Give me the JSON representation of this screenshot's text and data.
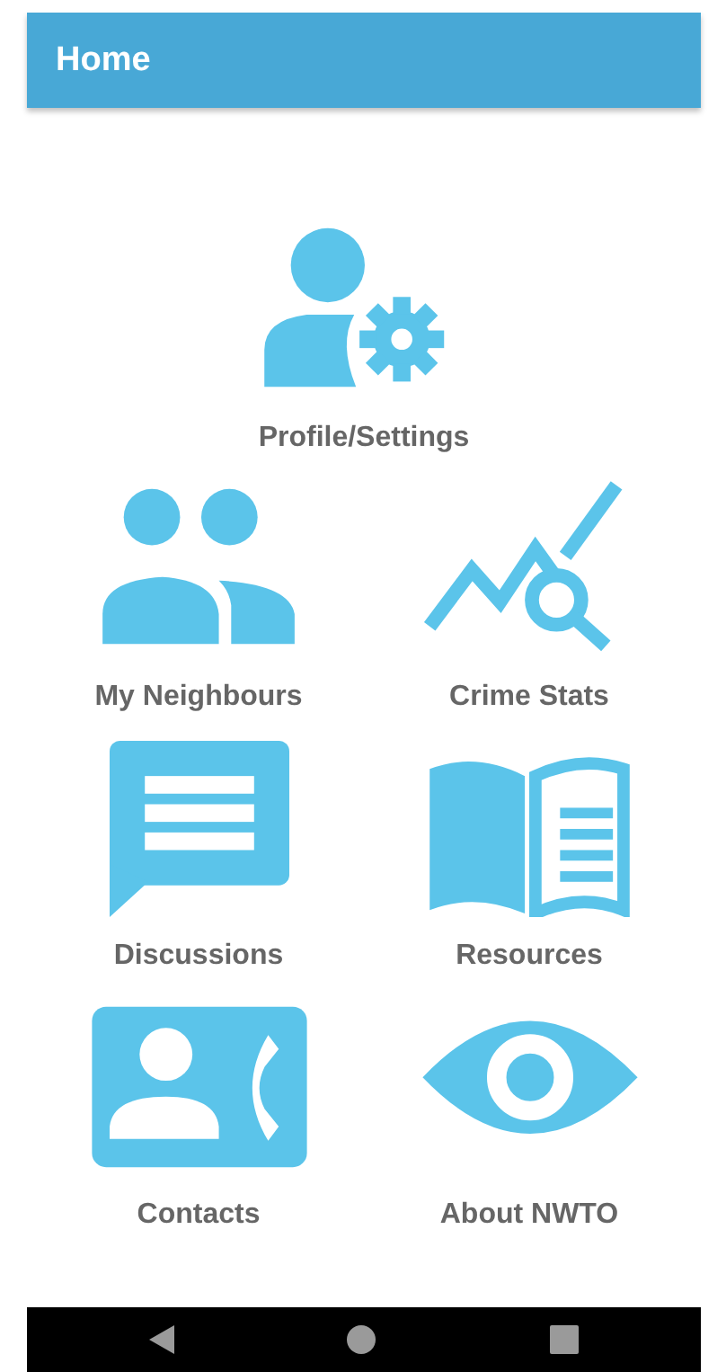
{
  "app_bar": {
    "title": "Home"
  },
  "tiles": [
    {
      "kind": "profile",
      "label": "Profile/Settings"
    },
    {
      "kind": "neighbours",
      "label": "My Neighbours"
    },
    {
      "kind": "stats",
      "label": "Crime Stats"
    },
    {
      "kind": "discussions",
      "label": "Discussions"
    },
    {
      "kind": "resources",
      "label": "Resources"
    },
    {
      "kind": "contacts",
      "label": "Contacts"
    },
    {
      "kind": "about",
      "label": "About NWTO"
    }
  ]
}
